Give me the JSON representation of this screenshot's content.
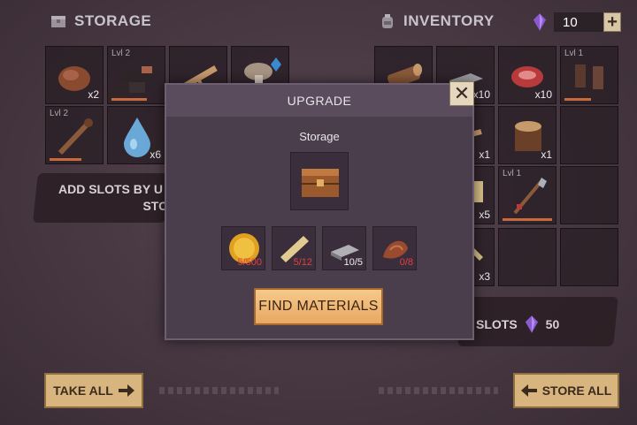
{
  "storage": {
    "title": "STORAGE",
    "slots": [
      {
        "item": "rock",
        "qty": "x2",
        "lvl": ""
      },
      {
        "item": "anvil",
        "qty": "",
        "lvl": "Lvl 2"
      },
      {
        "item": "branch",
        "qty": "",
        "lvl": ""
      },
      {
        "item": "mushroom",
        "qty": "",
        "lvl": ""
      },
      {
        "item": "club",
        "qty": "",
        "lvl": "Lvl 2"
      },
      {
        "item": "water-drop",
        "qty": "x6",
        "lvl": ""
      }
    ],
    "add_slots_text_line1": "ADD SLOTS BY U",
    "add_slots_text_line2": "STO"
  },
  "inventory": {
    "title": "INVENTORY",
    "crystals": "10",
    "plus_label": "+",
    "slots": [
      {
        "item": "log",
        "qty": "",
        "lvl": ""
      },
      {
        "item": "iron-bar",
        "qty": "x10",
        "lvl": ""
      },
      {
        "item": "raw-meat",
        "qty": "x10",
        "lvl": ""
      },
      {
        "item": "boots",
        "qty": "",
        "lvl": "Lvl 1"
      },
      {
        "item": "branch",
        "qty": "x1",
        "lvl": ""
      },
      {
        "item": "stump",
        "qty": "x1",
        "lvl": ""
      },
      {
        "item": "plank",
        "qty": "x5",
        "lvl": ""
      },
      {
        "item": "spear",
        "qty": "",
        "lvl": "Lvl 1"
      },
      {
        "item": "plank",
        "qty": "x3",
        "lvl": ""
      }
    ],
    "slots_label": "SLOTS",
    "slots_cost": "50"
  },
  "upgrade_modal": {
    "title": "UPGRADE",
    "target_name": "Storage",
    "close_label": "✕",
    "materials": [
      {
        "item": "gold-coin",
        "need": "5/500",
        "ok": false
      },
      {
        "item": "plank",
        "need": "5/12",
        "ok": false
      },
      {
        "item": "iron-bar",
        "need": "10/5",
        "ok": true
      },
      {
        "item": "leather",
        "need": "0/8",
        "ok": false
      }
    ],
    "find_button": "FIND MATERIALS"
  },
  "buttons": {
    "take_all": "TAKE ALL",
    "store_all": "STORE ALL"
  },
  "colors": {
    "accent": "#e8a862",
    "crystal": "#8a5ad0",
    "need_missing": "#e04040"
  }
}
